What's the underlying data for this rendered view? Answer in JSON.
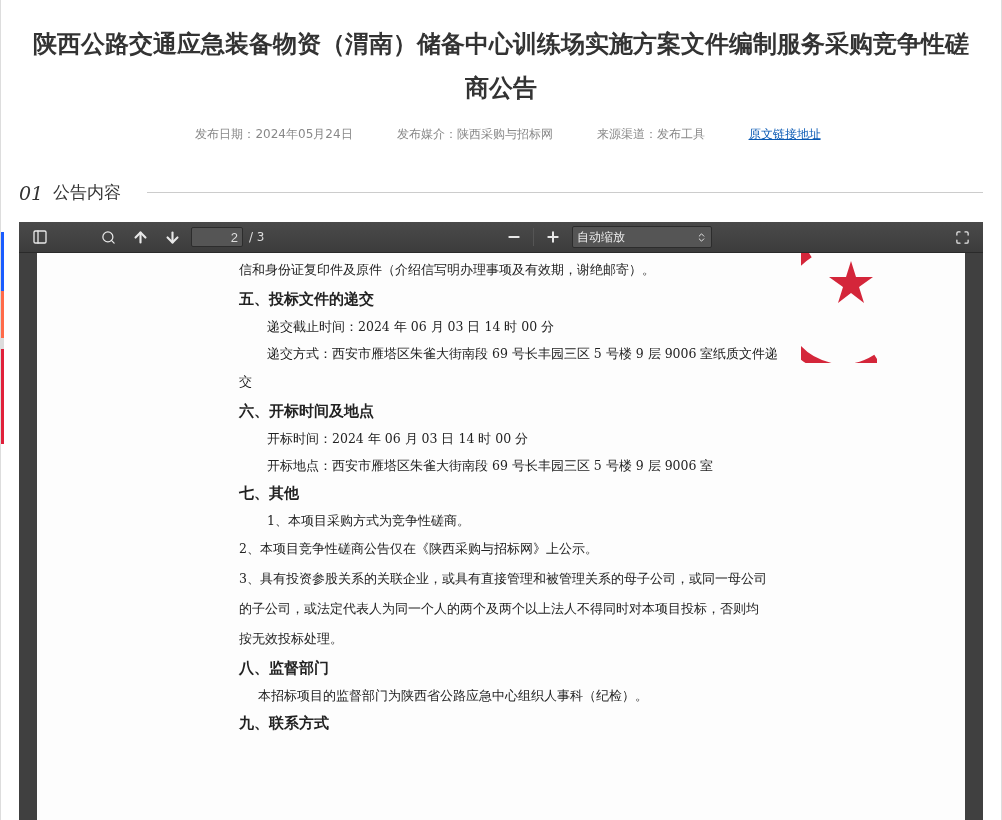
{
  "title": "陕西公路交通应急装备物资（渭南）储备中心训练场实施方案文件编制服务采购竞争性磋商公告",
  "meta": [
    {
      "kind": "text",
      "text": "发布日期：2024年05月24日"
    },
    {
      "kind": "text",
      "text": "发布媒介：陕西采购与招标网"
    },
    {
      "kind": "text",
      "text": "来源渠道：发布工具"
    },
    {
      "kind": "link",
      "text": "原文链接地址"
    }
  ],
  "section": {
    "number": "01",
    "title": "公告内容"
  },
  "viewer": {
    "toolbar": {
      "page": "2",
      "total": "/ 3",
      "zoom": "自动缩放"
    },
    "lines": [
      {
        "kind": "para",
        "text": "信和身份证复印件及原件（介绍信写明办理事项及有效期，谢绝邮寄）。"
      },
      {
        "kind": "heading",
        "text": "五、投标文件的递交"
      },
      {
        "kind": "indent",
        "text": "递交截止时间：2024 年 06 月 03 日  14 时 00 分"
      },
      {
        "kind": "indent",
        "text": "递交方式：西安市雁塔区朱雀大街南段 69 号长丰园三区 5 号楼 9 层 9006 室纸质文件递"
      },
      {
        "kind": "para",
        "text": "交"
      },
      {
        "kind": "heading",
        "text": "六、开标时间及地点"
      },
      {
        "kind": "indent",
        "text": "开标时间：2024 年 06 月 03 日  14 时 00 分"
      },
      {
        "kind": "indent",
        "text": "开标地点：西安市雁塔区朱雀大街南段 69 号长丰园三区 5 号楼 9 层 9006 室"
      },
      {
        "kind": "heading",
        "text": "七、其他"
      },
      {
        "kind": "indent",
        "text": "1、本项目采购方式为竞争性磋商。"
      },
      {
        "kind": "para",
        "text": "2、本项目竞争性磋商公告仅在《陕西采购与招标网》上公示。"
      },
      {
        "kind": "para",
        "text": "3、具有投资参股关系的关联企业，或具有直接管理和被管理关系的母子公司，或同一母公司"
      },
      {
        "kind": "para",
        "text": "的子公司，或法定代表人为同一个人的两个及两个以上法人不得同时对本项目投标，否则均"
      },
      {
        "kind": "para",
        "text": "按无效投标处理。"
      },
      {
        "kind": "heading",
        "text": "八、监督部门"
      },
      {
        "kind": "small-indent",
        "text": "本招标项目的监督部门为陕西省公路应急中心组织人事科（纪检）。"
      },
      {
        "kind": "heading",
        "text": "九、联系方式"
      }
    ]
  }
}
